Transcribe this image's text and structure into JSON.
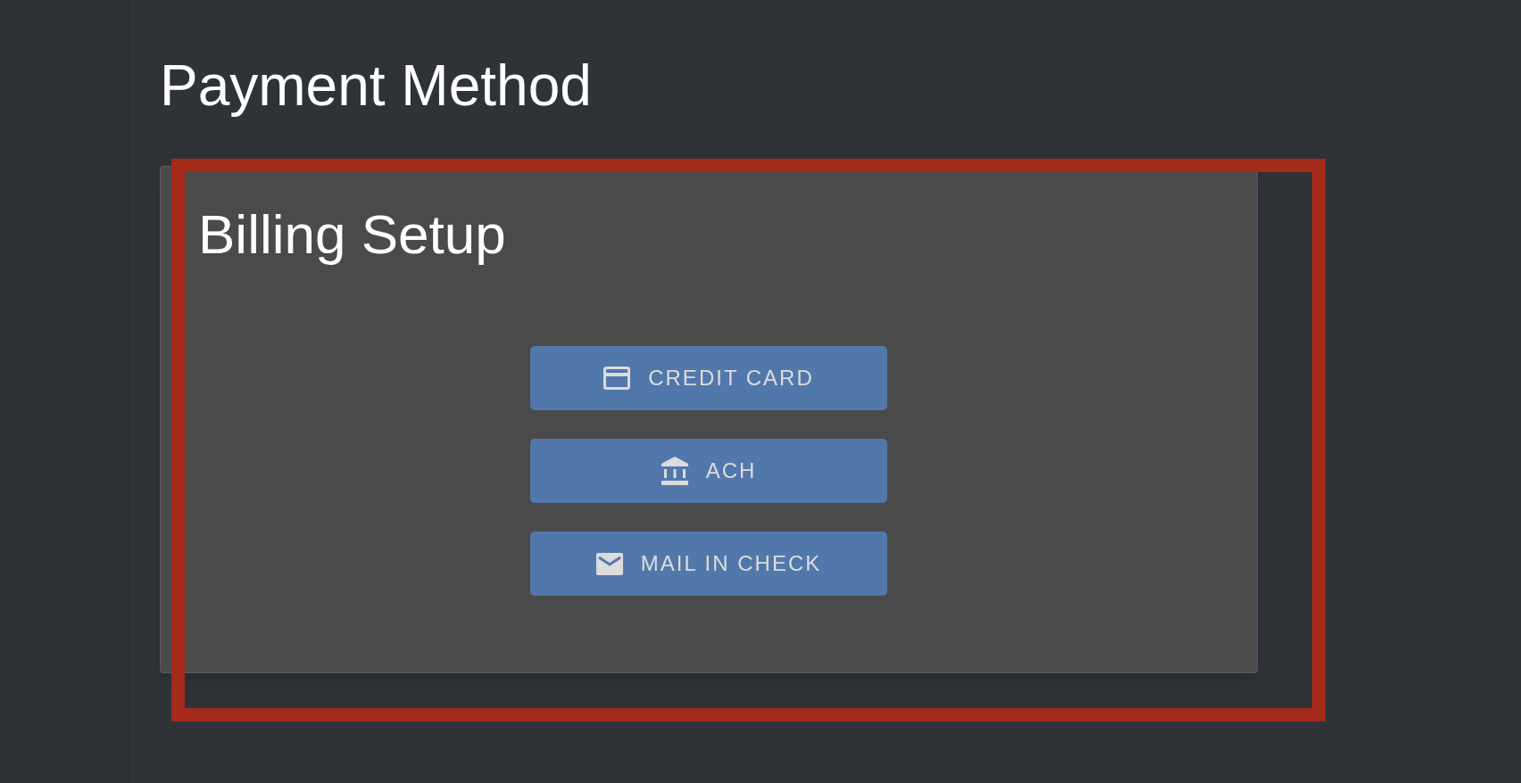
{
  "page_title": "Payment Method",
  "card": {
    "title": "Billing Setup",
    "buttons": [
      {
        "kind": "card",
        "label": "CREDIT CARD"
      },
      {
        "kind": "bank",
        "label": "ACH"
      },
      {
        "kind": "mail",
        "label": "MAIL IN CHECK"
      }
    ]
  }
}
